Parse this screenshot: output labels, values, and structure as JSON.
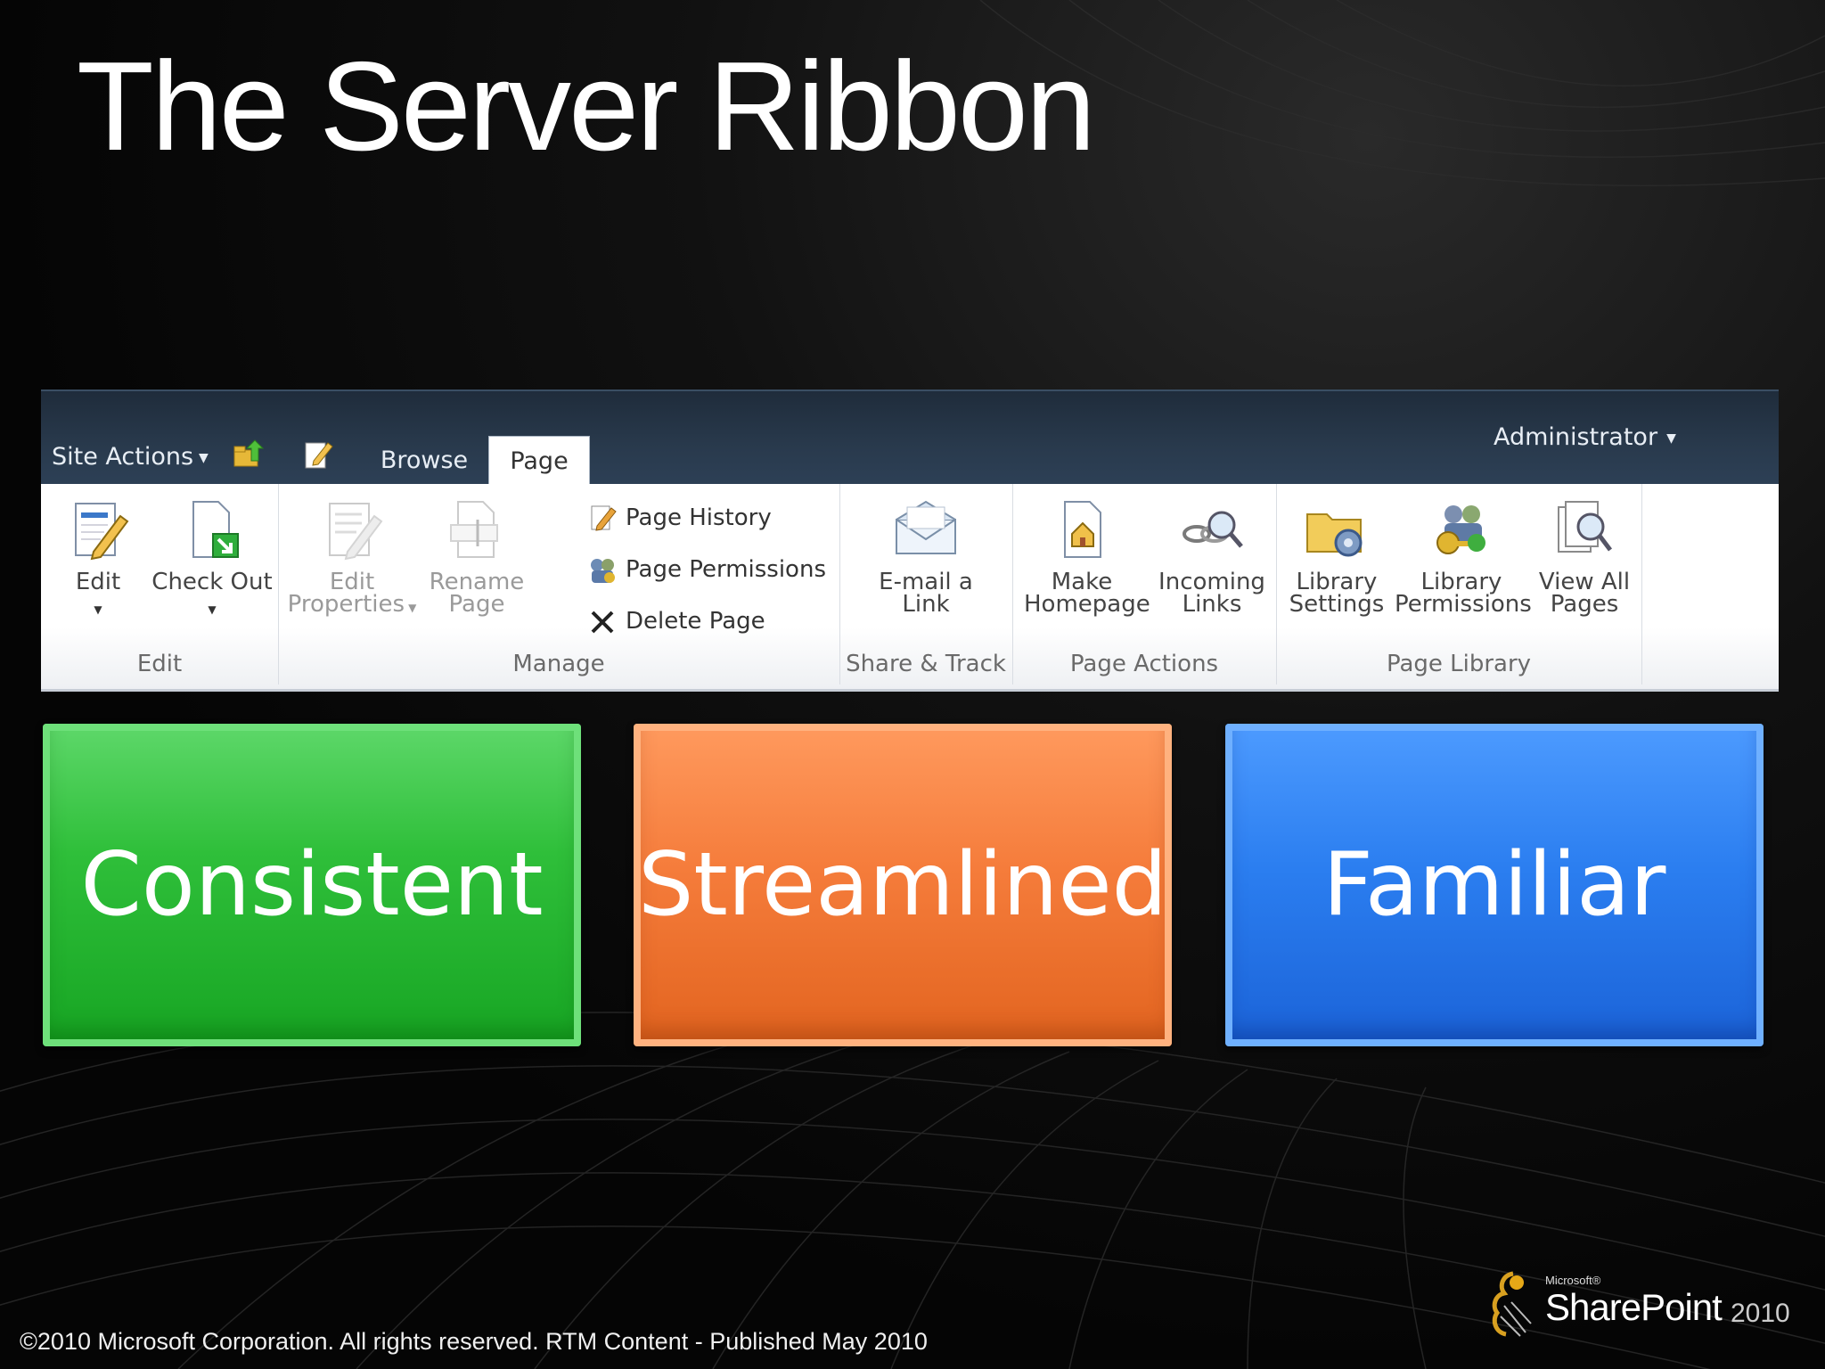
{
  "slide": {
    "title": "The Server Ribbon",
    "copyright": "©2010 Microsoft Corporation. All rights reserved. RTM Content - Published May 2010"
  },
  "ribbon": {
    "site_actions_label": "Site Actions",
    "tabs": [
      {
        "label": "Browse",
        "selected": false
      },
      {
        "label": "Page",
        "selected": true
      }
    ],
    "user_label": "Administrator",
    "groups": [
      {
        "label": "Edit",
        "buttons": [
          {
            "label": "Edit",
            "icon": "edit-page-icon",
            "has_dropdown": true
          },
          {
            "label": "Check Out",
            "icon": "check-out-icon",
            "has_dropdown": true
          }
        ]
      },
      {
        "label": "Manage",
        "buttons": [
          {
            "label": "Edit Properties",
            "icon": "edit-properties-icon",
            "has_dropdown": true,
            "enabled": false
          },
          {
            "label": "Rename Page",
            "icon": "rename-page-icon",
            "enabled": false
          },
          {
            "label": "Page History",
            "icon": "page-history-icon"
          },
          {
            "label": "Page Permissions",
            "icon": "page-permissions-icon"
          },
          {
            "label": "Delete Page",
            "icon": "delete-icon"
          }
        ]
      },
      {
        "label": "Share & Track",
        "buttons": [
          {
            "label": "E-mail a Link",
            "icon": "email-icon"
          }
        ]
      },
      {
        "label": "Page Actions",
        "buttons": [
          {
            "label": "Make Homepage",
            "icon": "homepage-icon"
          },
          {
            "label": "Incoming Links",
            "icon": "incoming-links-icon"
          }
        ]
      },
      {
        "label": "Page Library",
        "buttons": [
          {
            "label": "Library Settings",
            "icon": "library-settings-icon"
          },
          {
            "label": "Library Permissions",
            "icon": "library-permissions-icon"
          },
          {
            "label": "View All Pages",
            "icon": "view-all-pages-icon"
          }
        ]
      }
    ]
  },
  "boxes": [
    {
      "label": "Consistent",
      "color": "#2fbf3a"
    },
    {
      "label": "Streamlined",
      "color": "#f57c3b"
    },
    {
      "label": "Familiar",
      "color": "#2b7ef0"
    }
  ],
  "logo": {
    "microsoft": "Microsoft®",
    "product": "SharePoint",
    "year": "2010"
  }
}
